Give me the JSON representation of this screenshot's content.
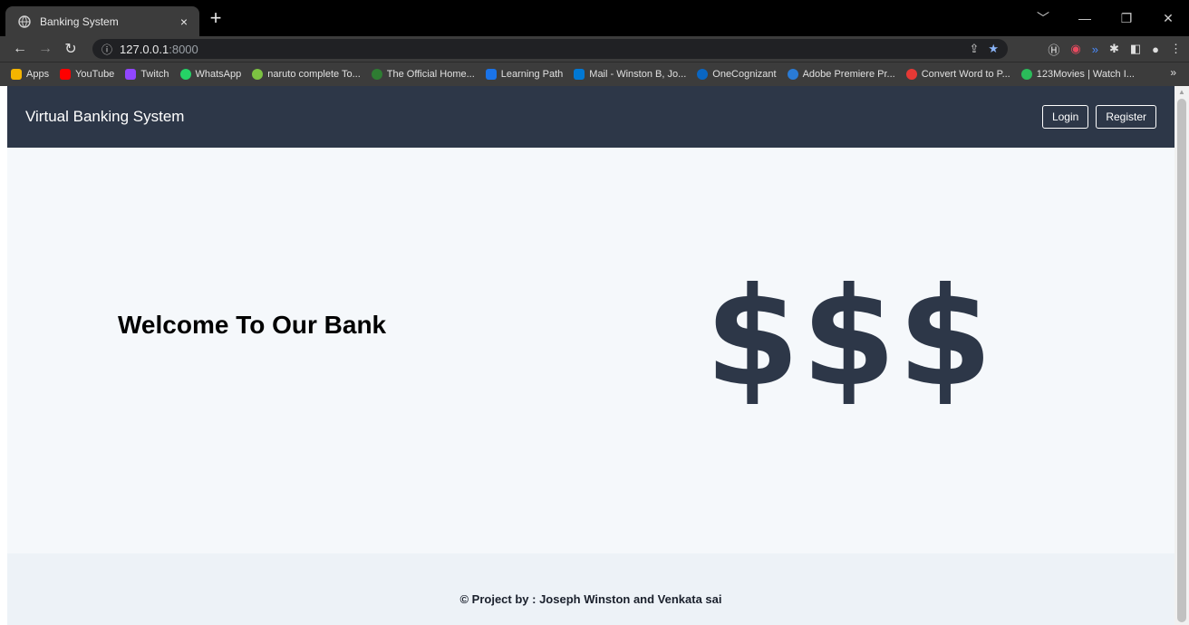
{
  "browser": {
    "tab_title": "Banking System",
    "tab_close": "×",
    "new_tab": "+",
    "url_host": "127.0.0.1",
    "url_port": ":8000",
    "bookmarks": [
      {
        "label": "Apps",
        "color": "#f4b400"
      },
      {
        "label": "YouTube",
        "color": "#ff0000"
      },
      {
        "label": "Twitch",
        "color": "#9146ff"
      },
      {
        "label": "WhatsApp",
        "color": "#25d366"
      },
      {
        "label": "naruto complete To...",
        "color": "#7cc242"
      },
      {
        "label": "The Official Home...",
        "color": "#2e7d32"
      },
      {
        "label": "Learning Path",
        "color": "#1a73e8"
      },
      {
        "label": "Mail - Winston B, Jo...",
        "color": "#0078d4"
      },
      {
        "label": "OneCognizant",
        "color": "#0a66c2"
      },
      {
        "label": "Adobe Premiere Pr...",
        "color": "#2a7bd5"
      },
      {
        "label": "Convert Word to P...",
        "color": "#e53935"
      },
      {
        "label": "123Movies | Watch I...",
        "color": "#2bbb5a"
      }
    ],
    "bookmarks_more": "»"
  },
  "navbar": {
    "brand": "Virtual Banking System",
    "login_label": "Login",
    "register_label": "Register",
    "bg_color": "#2d3748"
  },
  "hero": {
    "welcome": "Welcome To Our Bank",
    "dollar_signs": "$$$"
  },
  "footer": {
    "text": "© Project by : Joseph Winston and Venkata sai"
  }
}
